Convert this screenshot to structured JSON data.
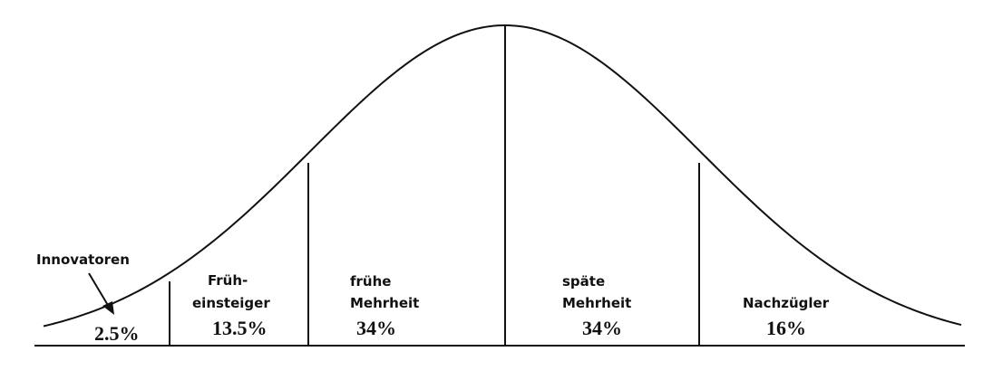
{
  "segments": [
    {
      "id": "innovators",
      "name_lines": [
        "Innovatoren"
      ],
      "percent": "2.5%"
    },
    {
      "id": "early-adopters",
      "name_lines": [
        "Früh-",
        "einsteiger"
      ],
      "percent": "13.5%"
    },
    {
      "id": "early-majority",
      "name_lines": [
        "frühe",
        "Mehrheit"
      ],
      "percent": "34%"
    },
    {
      "id": "late-majority",
      "name_lines": [
        "späte",
        "Mehrheit"
      ],
      "percent": "34%"
    },
    {
      "id": "laggards",
      "name_lines": [
        "Nachzügler"
      ],
      "percent": "16%"
    }
  ],
  "colors": {
    "ink": "#111111",
    "background": "#ffffff"
  }
}
